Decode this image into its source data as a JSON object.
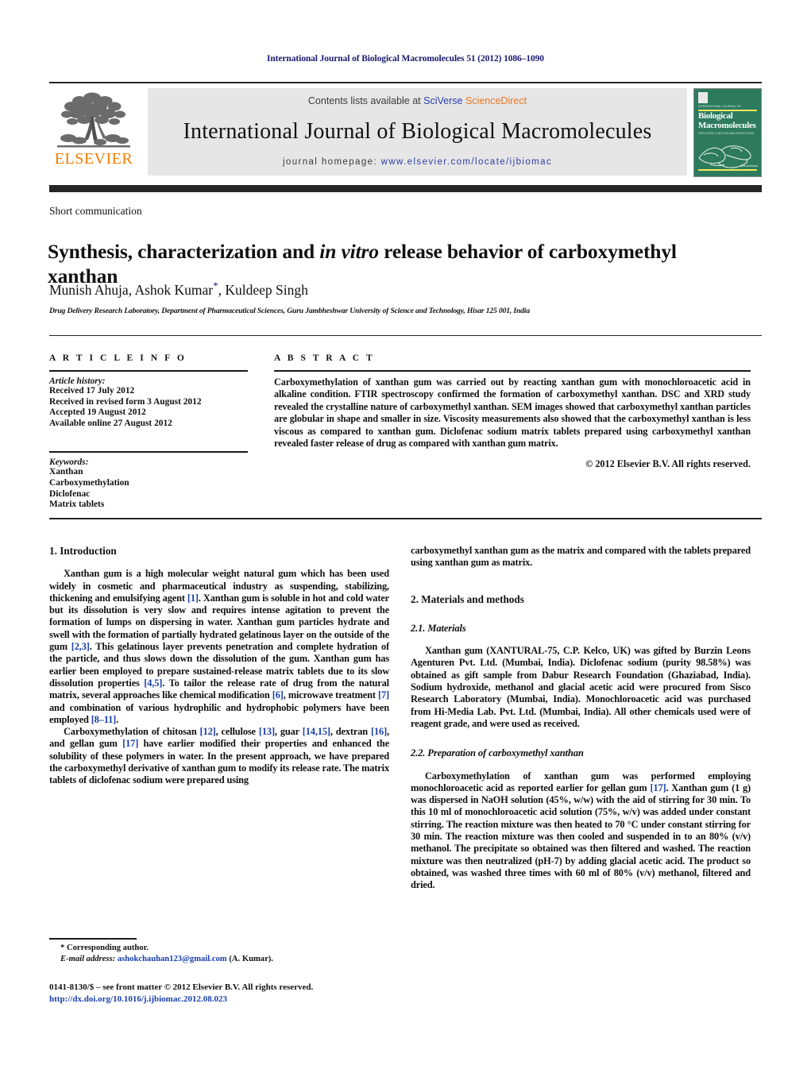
{
  "running_head": "International Journal of Biological Macromolecules 51 (2012) 1086–1090",
  "masthead": {
    "publisher": "ELSEVIER",
    "contents_prefix": "Contents lists available at ",
    "contents_link_a": "SciVerse",
    "contents_link_b": "ScienceDirect",
    "journal_title": "International Journal of Biological Macromolecules",
    "homepage_label": "journal homepage:",
    "homepage_url": "www.elsevier.com/locate/ijbiomac",
    "cover": {
      "top_label": "INTERNATIONAL JOURNAL OF",
      "title_line1": "Biological",
      "title_line2": "Macromolecules",
      "subtitle": "STRUCTURE, FUNCTION AND INTERACTIONS",
      "badge": "Available online at\nScienceDirect\nwww.sciencedirect.com"
    }
  },
  "article": {
    "type": "Short communication",
    "title_part1": "Synthesis, characterization and ",
    "title_italic": "in vitro",
    "title_part2": " release behavior of carboxymethyl xanthan",
    "authors": "Munish Ahuja, Ashok Kumar",
    "author_marker": "*",
    "authors_tail": ", Kuldeep Singh",
    "affiliation": "Drug Delivery Research Laboratory, Department of Pharmaceutical Sciences, Guru Jambheshwar University of Science and Technology, Hisar 125 001, India"
  },
  "info": {
    "heading": "A R T I C L E    I N F O",
    "history_label": "Article history:",
    "history": [
      "Received 17 July 2012",
      "Received in revised form 3 August 2012",
      "Accepted 19 August 2012",
      "Available online 27 August 2012"
    ],
    "keywords_label": "Keywords:",
    "keywords": [
      "Xanthan",
      "Carboxymethylation",
      "Diclofenac",
      "Matrix tablets"
    ]
  },
  "abstract": {
    "heading": "A B S T R A C T",
    "text": "Carboxymethylation of xanthan gum was carried out by reacting xanthan gum with monochloroacetic acid in alkaline condition. FTIR spectroscopy confirmed the formation of carboxymethyl xanthan. DSC and XRD study revealed the crystalline nature of carboxymethyl xanthan. SEM images showed that carboxymethyl xanthan particles are globular in shape and smaller in size. Viscosity measurements also showed that the carboxymethyl xanthan is less viscous as compared to xanthan gum. Diclofenac sodium matrix tablets prepared using carboxymethyl xanthan revealed faster release of drug as compared with xanthan gum matrix.",
    "copyright": "© 2012 Elsevier B.V. All rights reserved."
  },
  "sections": {
    "introduction_heading": "1.  Introduction",
    "intro_p1_a": "Xanthan gum is a high molecular weight natural gum which has been used widely in cosmetic and pharmaceutical industry as suspending, stabilizing, thickening and emulsifying agent ",
    "intro_p1_r1": "[1]",
    "intro_p1_b": ". Xanthan gum is soluble in hot and cold water but its dissolution is very slow and requires intense agitation to prevent the formation of lumps on dispersing in water. Xanthan gum particles hydrate and swell with the formation of partially hydrated gelatinous layer on the outside of the gum ",
    "intro_p1_r2": "[2,3]",
    "intro_p1_c": ". This gelatinous layer prevents penetration and complete hydration of the particle, and thus slows down the dissolution of the gum. Xanthan gum has earlier been employed to prepare sustained-release matrix tablets due to its slow dissolution properties ",
    "intro_p1_r3": "[4,5]",
    "intro_p1_d": ". To tailor the release rate of drug from the natural matrix, several approaches like chemical modification ",
    "intro_p1_r4": "[6]",
    "intro_p1_e": ", microwave treatment ",
    "intro_p1_r5": "[7]",
    "intro_p1_f": " and combination of various hydrophilic and hydrophobic polymers have been employed ",
    "intro_p1_r6": "[8–11]",
    "intro_p1_g": ".",
    "intro_p2_a": "Carboxymethylation of chitosan ",
    "intro_p2_r1": "[12]",
    "intro_p2_b": ", cellulose ",
    "intro_p2_r2": "[13]",
    "intro_p2_c": ", guar ",
    "intro_p2_r3": "[14,15]",
    "intro_p2_d": ", dextran ",
    "intro_p2_r4": "[16]",
    "intro_p2_e": ", and gellan gum ",
    "intro_p2_r5": "[17]",
    "intro_p2_f": " have earlier modified their properties and enhanced the solubility of these polymers in water. In the present approach, we have prepared the carboxymethyl derivative of xanthan gum to modify its release rate. The matrix tablets of diclofenac sodium were prepared using",
    "intro_p2_cont": "carboxymethyl xanthan gum as the matrix and compared with the tablets prepared using xanthan gum as matrix.",
    "materials_methods_heading": "2.  Materials and methods",
    "materials_heading": "2.1.  Materials",
    "materials_text": "Xanthan gum (XANTURAL-75, C.P. Kelco, UK) was gifted by Burzin Leons Agenturen Pvt. Ltd. (Mumbai, India). Diclofenac sodium (purity 98.58%) was obtained as gift sample from Dabur Research Foundation (Ghaziabad, India). Sodium hydroxide, methanol and glacial acetic acid were procured from Sisco Research Laboratory (Mumbai, India). Monochloroacetic acid was purchased from Hi-Media Lab. Pvt. Ltd. (Mumbai, India). All other chemicals used were of reagent grade, and were used as received.",
    "preparation_heading": "2.2.  Preparation of carboxymethyl xanthan",
    "prep_a": "Carboxymethylation of xanthan gum was performed employing monochloroacetic acid as reported earlier for gellan gum ",
    "prep_r1": "[17]",
    "prep_b": ". Xanthan gum (1 g) was dispersed in NaOH solution (45%, w/w) with the aid of stirring for 30 min. To this 10 ml of monochloroacetic acid solution (75%, w/v) was added under constant stirring. The reaction mixture was then heated to 70 °C under constant stirring for 30 min. The reaction mixture was then cooled and suspended in to an 80% (v/v) methanol. The precipitate so obtained was then filtered and washed. The reaction mixture was then neutralized (pH-7) by adding glacial acetic acid. The product so obtained, was washed three times with 60 ml of 80% (v/v) methanol, filtered and dried."
  },
  "footnote": {
    "corresponding": "* Corresponding author.",
    "email_label": "E-mail address:",
    "email": "ashokchauhan123@gmail.com",
    "email_suffix": " (A. Kumar)."
  },
  "footer": {
    "issn_line": "0141-8130/$ – see front matter © 2012 Elsevier B.V. All rights reserved.",
    "doi": "http://dx.doi.org/10.1016/j.ijbiomac.2012.08.023"
  }
}
